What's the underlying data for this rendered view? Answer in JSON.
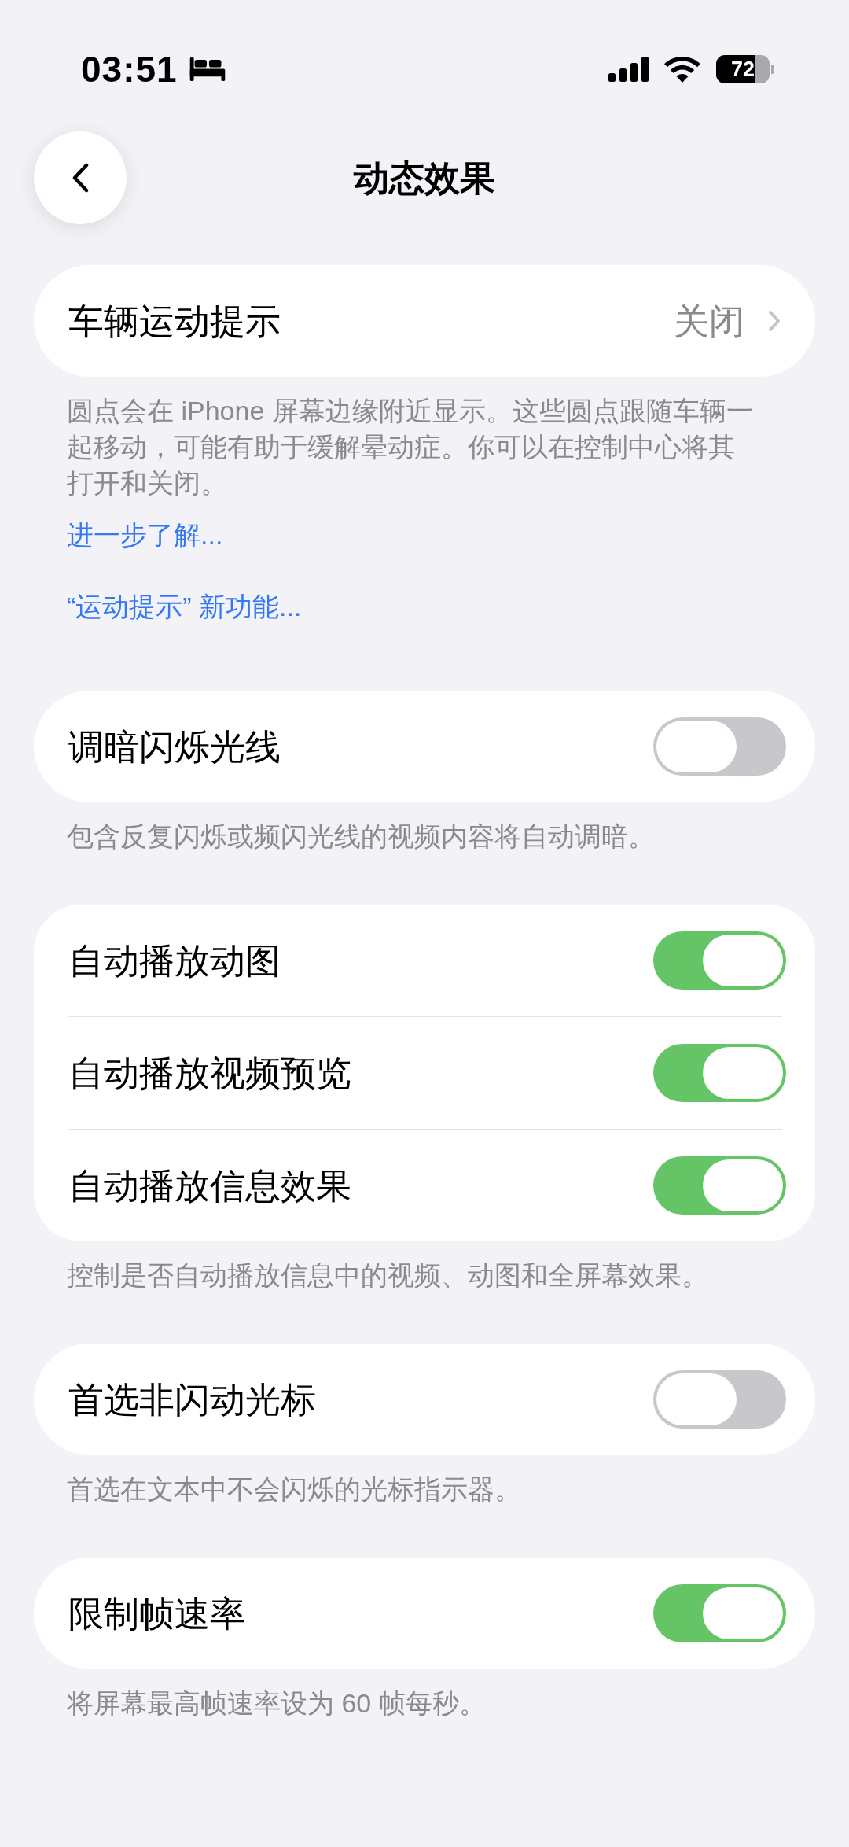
{
  "status_bar": {
    "time": "03:51",
    "battery": "72"
  },
  "nav_bar": {
    "title": "动态效果"
  },
  "sections": [
    {
      "rows": [
        {
          "kind": "link",
          "label": "车辆运动提示",
          "value": "关闭"
        }
      ],
      "footer": "圆点会在 iPhone 屏幕边缘附近显示。这些圆点跟随车辆一起移动，可能有助于缓解晕动症。你可以在控制中心将其打开和关闭。",
      "links": [
        "进一步了解...",
        "“运动提示” 新功能..."
      ]
    },
    {
      "rows": [
        {
          "kind": "toggle",
          "label": "调暗闪烁光线",
          "on": false
        }
      ],
      "footer": "包含反复闪烁或频闪光线的视频内容将自动调暗。"
    },
    {
      "rows": [
        {
          "kind": "toggle",
          "label": "自动播放动图",
          "on": true
        },
        {
          "kind": "toggle",
          "label": "自动播放视频预览",
          "on": true
        },
        {
          "kind": "toggle",
          "label": "自动播放信息效果",
          "on": true
        }
      ],
      "footer": "控制是否自动播放信息中的视频、动图和全屏幕效果。"
    },
    {
      "rows": [
        {
          "kind": "toggle",
          "label": "首选非闪动光标",
          "on": false
        }
      ],
      "footer": "首选在文本中不会闪烁的光标指示器。"
    },
    {
      "rows": [
        {
          "kind": "toggle",
          "label": "限制帧速率",
          "on": true
        }
      ],
      "footer": "将屏幕最高帧速率设为 60 帧每秒。"
    }
  ]
}
